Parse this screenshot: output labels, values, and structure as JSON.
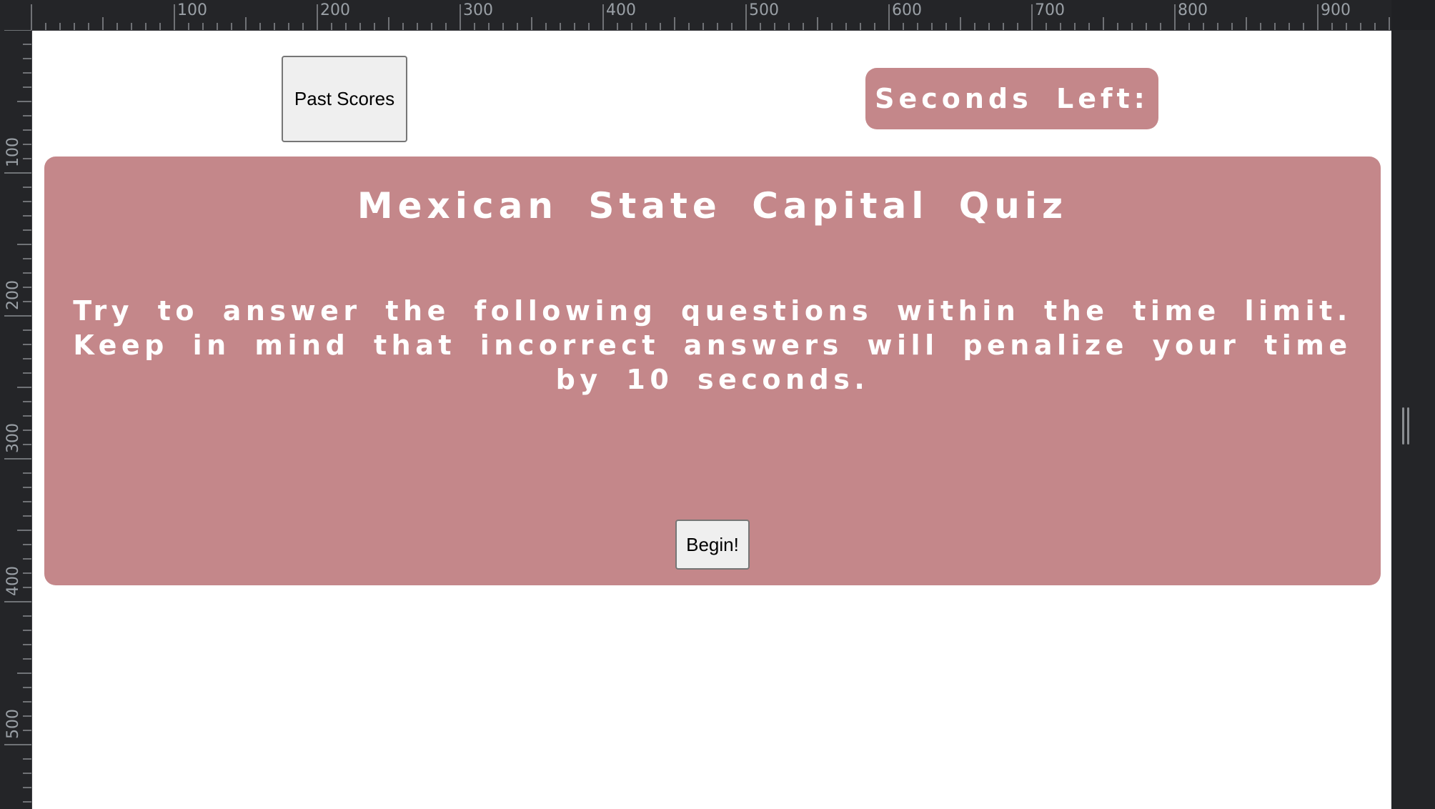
{
  "ruler": {
    "top_labels": [
      "100",
      "200",
      "300",
      "400",
      "500",
      "600",
      "700",
      "800",
      "900"
    ],
    "left_labels": [
      "100",
      "200",
      "300",
      "400",
      "500"
    ]
  },
  "header": {
    "past_scores_label": "Past Scores",
    "timer_label": "Seconds Left:"
  },
  "quiz": {
    "title": "Mexican State Capital Quiz",
    "instructions": "Try to answer the following questions within the time limit. Keep in mind that incorrect answers will penalize your time by 10 seconds.",
    "begin_label": "Begin!"
  },
  "colors": {
    "card_background": "#c4878a",
    "button_background": "#efefef",
    "page_background": "#ffffff"
  }
}
